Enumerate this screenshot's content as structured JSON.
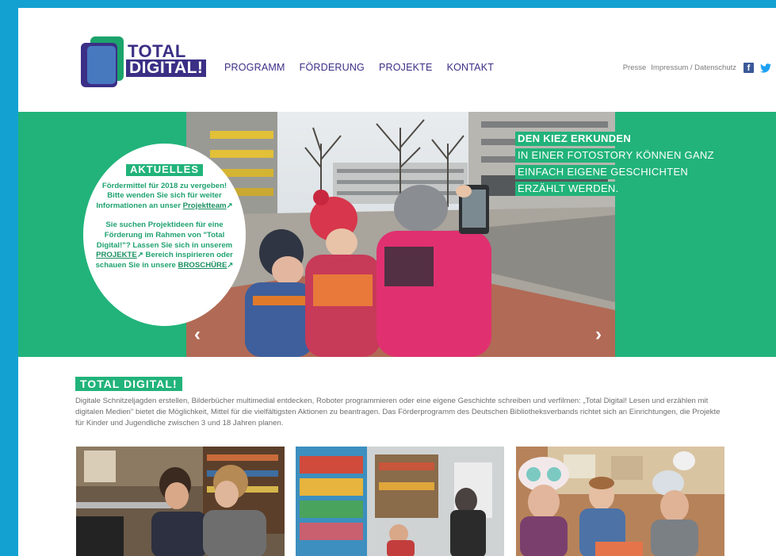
{
  "logo": {
    "line1": "TOTAL",
    "line2": "DIGITAL!"
  },
  "nav": [
    "PROGRAMM",
    "FÖRDERUNG",
    "PROJEKTE",
    "KONTAKT"
  ],
  "util": {
    "presse": "Presse",
    "impressum": "Impressum / Datenschutz",
    "facebook_icon": "facebook-icon",
    "twitter_icon": "twitter-icon"
  },
  "aktuelles": {
    "title": "AKTUELLES",
    "p1_text": "Fördermittel für 2018 zu vergeben! Bitte wenden Sie sich für weiter Informationen an unser ",
    "p1_link": "Projektteam",
    "p2_text": "Sie suchen Projektideen für eine Förderung im Rahmen von \"Total Digital!\"? Lassen Sie sich in unserem ",
    "p2_link1": "PROJEKTE",
    "p2_mid": " Bereich inspirieren oder schauen Sie in unsere ",
    "p2_link2": "BROSCHÜRE"
  },
  "slider": {
    "prev_icon": "chevron-left-icon",
    "next_icon": "chevron-right-icon",
    "caption": [
      "DEN KIEZ ERKUNDEN",
      "IN EINER FOTOSTORY KÖNNEN GANZ",
      "EINFACH EIGENE GESCHICHTEN",
      "ERZÄHLT WERDEN."
    ]
  },
  "section": {
    "title": "TOTAL DIGITAL!",
    "body": "Digitale Schnitzeljagden erstellen, Bilderbücher multimedial entdecken, Roboter programmieren oder eine eigene Geschichte schreiben und verfilmen: „Total Digital! Lesen und erzählen mit digitalen Medien\" bietet die Möglichkeit, Mittel für die vielfältigsten Aktionen zu beantragen. Das Förderprogramm des Deutschen Bibliotheksverbands richtet sich an Einrichtungen, die Projekte für Kinder und Jugendliche zwischen 3 und 18 Jahren planen."
  },
  "colors": {
    "brand_green": "#21b37a",
    "brand_purple": "#3b2f86",
    "frame_blue": "#13a1d2"
  }
}
